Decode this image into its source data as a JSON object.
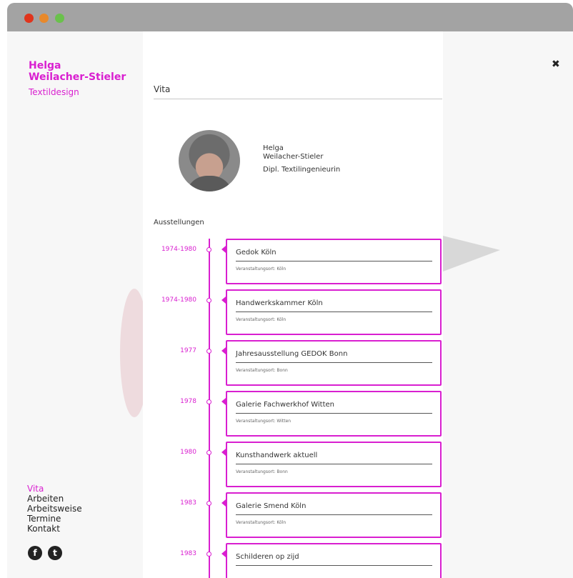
{
  "brand": {
    "name_line1": "Helga",
    "name_line2": "Weilacher-Stieler",
    "subtitle": "Textildesign"
  },
  "header": {
    "close_label": "✖"
  },
  "section": {
    "title": "Vita"
  },
  "profile": {
    "first": "Helga",
    "last": "Weilacher-Stieler",
    "title": "Dipl. Textilingenieurin"
  },
  "exhibitions_label": "Ausstellungen",
  "exhibitions": [
    {
      "year": "1974-1980",
      "title": "Gedok Köln",
      "meta": "Veranstaltungsort: Köln"
    },
    {
      "year": "1974-1980",
      "title": "Handwerkskammer Köln",
      "meta": "Veranstaltungsort: Köln"
    },
    {
      "year": "1977",
      "title": "Jahresausstellung GEDOK Bonn",
      "meta": "Veranstaltungsort: Bonn"
    },
    {
      "year": "1978",
      "title": "Galerie Fachwerkhof Witten",
      "meta": "Veranstaltungsort: Witten"
    },
    {
      "year": "1980",
      "title": "Kunsthandwerk aktuell",
      "meta": "Veranstaltungsort: Bonn"
    },
    {
      "year": "1983",
      "title": "Galerie Smend Köln",
      "meta": "Veranstaltungsort: Köln"
    },
    {
      "year": "1983",
      "title": "Schilderen op zijd",
      "meta": ""
    }
  ],
  "nav": {
    "items": [
      "Vita",
      "Arbeiten",
      "Arbeitsweise",
      "Termine",
      "Kontakt"
    ],
    "active": "Vita"
  },
  "social": {
    "facebook": "f",
    "twitter": "t"
  },
  "colors": {
    "accent": "#d91fd0",
    "text": "#333333",
    "background": "#f7f7f7"
  }
}
